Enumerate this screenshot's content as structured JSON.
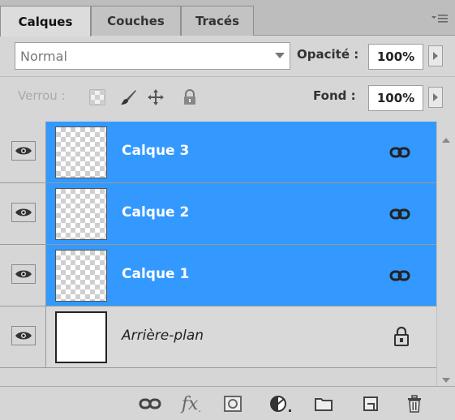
{
  "tabs": [
    {
      "label": "Calques",
      "active": true
    },
    {
      "label": "Couches",
      "active": false
    },
    {
      "label": "Tracés",
      "active": false
    }
  ],
  "menu_icon": "panel-menu-icon",
  "blend_mode": {
    "value": "Normal"
  },
  "opacity": {
    "label": "Opacité :",
    "value": "100%"
  },
  "lock": {
    "label": "Verrou :",
    "icons": [
      "lock-transparent-icon",
      "lock-brush-icon",
      "lock-move-icon",
      "lock-all-icon"
    ]
  },
  "fill": {
    "label": "Fond :",
    "value": "100%"
  },
  "layers": [
    {
      "name": "Calque 3",
      "selected": true,
      "visible": true,
      "thumb": "transparent",
      "badge": "link-icon"
    },
    {
      "name": "Calque 2",
      "selected": true,
      "visible": true,
      "thumb": "transparent",
      "badge": "link-icon"
    },
    {
      "name": "Calque 1",
      "selected": true,
      "visible": true,
      "thumb": "transparent",
      "badge": "link-icon"
    },
    {
      "name": "Arrière-plan",
      "selected": false,
      "visible": true,
      "thumb": "white",
      "badge": "lock-icon"
    }
  ],
  "bottom_toolbar": {
    "icons": [
      "link-layers-icon",
      "fx-icon",
      "layer-mask-icon",
      "adjustment-layer-icon",
      "new-group-icon",
      "new-layer-icon",
      "trash-icon"
    ],
    "fx_label": "fx"
  },
  "colors": {
    "selection": "#3399ff",
    "panel": "#d6d6d6",
    "tabbar": "#bdbdbd"
  }
}
